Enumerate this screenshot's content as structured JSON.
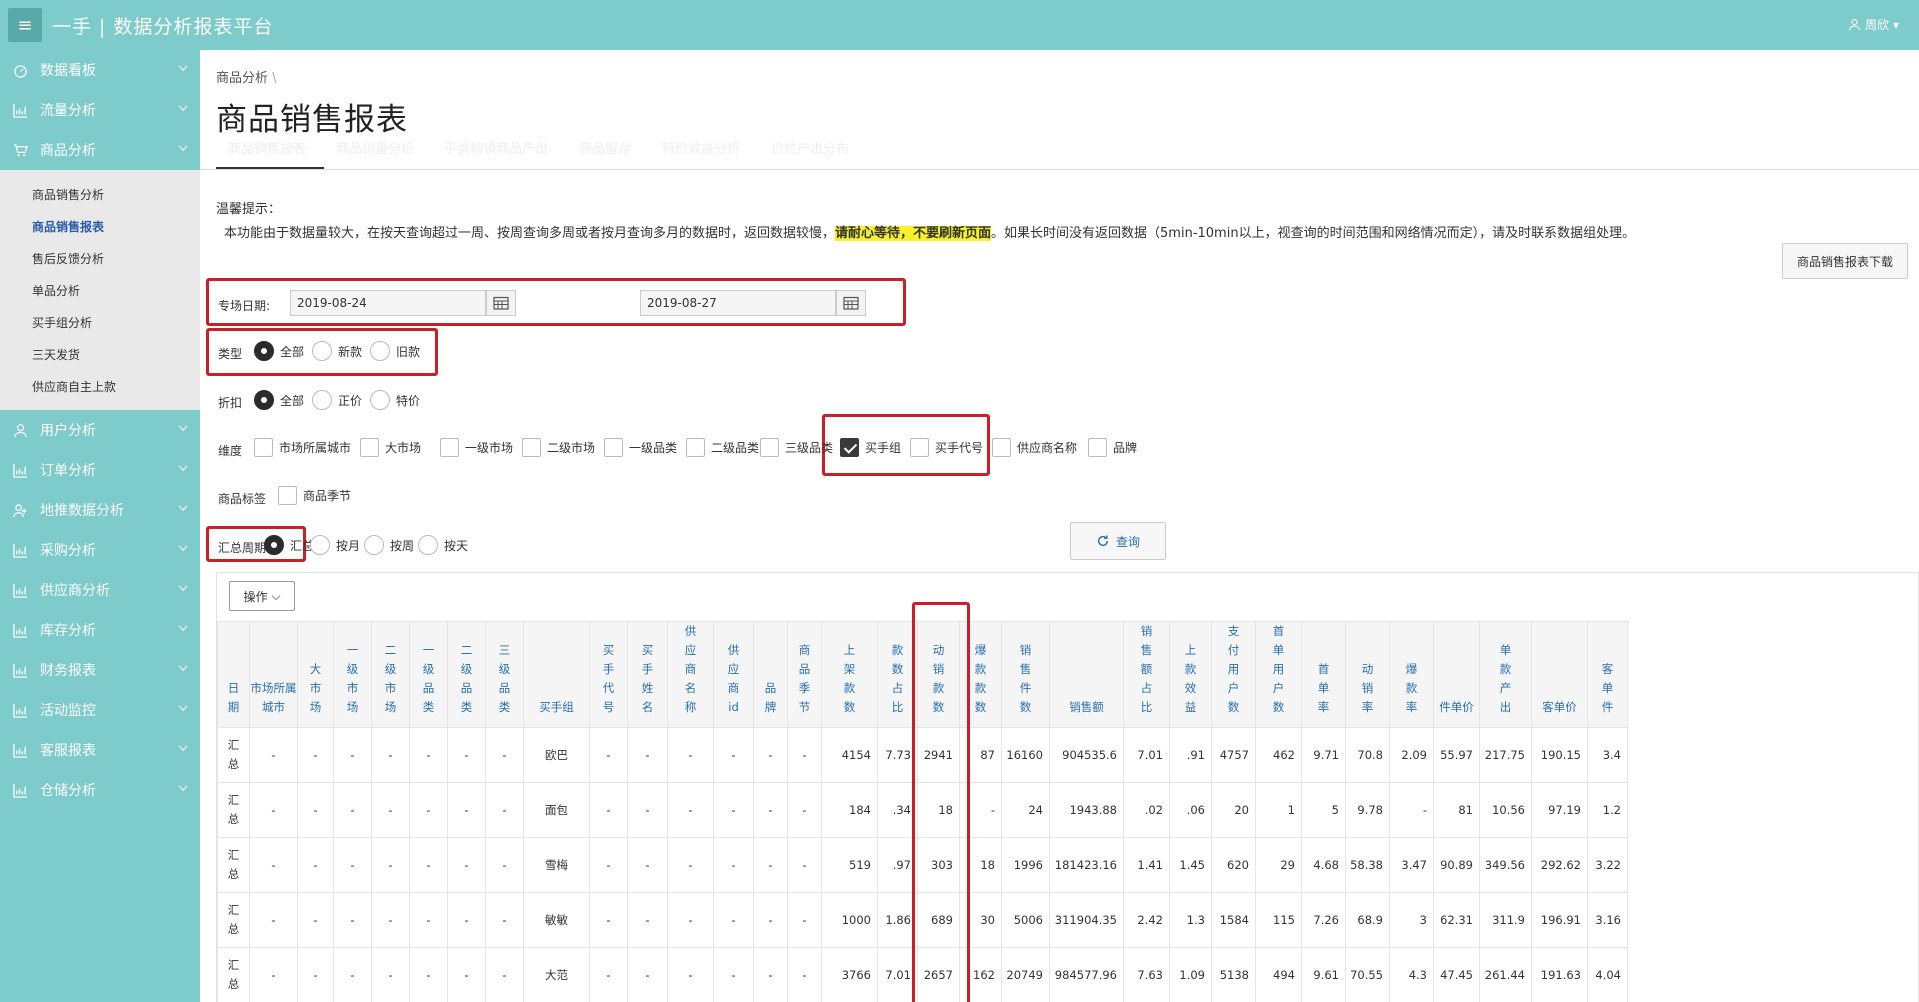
{
  "app": {
    "title": "一手 | 数据分析报表平台",
    "user": "周欣"
  },
  "sidebar": {
    "items": [
      {
        "label": "数据看板",
        "icon": "dashboard-icon"
      },
      {
        "label": "流量分析",
        "icon": "chart-icon"
      },
      {
        "label": "商品分析",
        "icon": "cart-icon"
      },
      {
        "label": "用户分析",
        "icon": "user-icon"
      },
      {
        "label": "订单分析",
        "icon": "chart-icon"
      },
      {
        "label": "地推数据分析",
        "icon": "user-plus-icon"
      },
      {
        "label": "采购分析",
        "icon": "chart-icon"
      },
      {
        "label": "供应商分析",
        "icon": "chart-icon"
      },
      {
        "label": "库存分析",
        "icon": "chart-icon"
      },
      {
        "label": "财务报表",
        "icon": "chart-icon"
      },
      {
        "label": "活动监控",
        "icon": "chart-icon"
      },
      {
        "label": "客服报表",
        "icon": "chart-icon"
      },
      {
        "label": "仓储分析",
        "icon": "chart-icon"
      }
    ],
    "sub_items": [
      "商品销售分析",
      "商品销售报表",
      "售后反馈分析",
      "单品分析",
      "买手组分析",
      "三天发货",
      "供应商自主上款"
    ]
  },
  "breadcrumb": "商品分析",
  "page_title": "商品销售报表",
  "tabs": [
    "商品销售报表",
    "商品销量分析",
    "平滑畅销商品产出",
    "商品留存",
    "特价效益分析",
    "价位产出分布"
  ],
  "notice": {
    "title": "温馨提示：",
    "before": "本功能由于数据量较大，在按天查询超过一周、按周查询多周或者按月查询多月的数据时，返回数据较慢，",
    "highlight": "请耐心等待，不要刷新页面",
    "after": "。如果长时间没有返回数据（5min-10min以上，视查询的时间范围和网络情况而定），请及时联系数据组处理。"
  },
  "download_label": "商品销售报表下载",
  "filters": {
    "date_label": "专场日期:",
    "date_start": "2019-08-24",
    "date_end": "2019-08-27",
    "type_label": "类型",
    "type_options": [
      "全部",
      "新款",
      "旧款"
    ],
    "discount_label": "折扣",
    "discount_options": [
      "全部",
      "正价",
      "特价"
    ],
    "dimension_label": "维度",
    "dimension_options": [
      "市场所属城市",
      "大市场",
      "一级市场",
      "二级市场",
      "一级品类",
      "二级品类",
      "三级品类",
      "买手组",
      "买手代号",
      "供应商名称",
      "品牌"
    ],
    "tag_label": "商品标签",
    "tag_options": [
      "商品季节"
    ],
    "period_label": "汇总周期",
    "period_options": [
      "汇总",
      "按月",
      "按周",
      "按天"
    ],
    "query_label": "查询"
  },
  "ops_label": "操作",
  "table": {
    "headers": [
      "日期",
      "市场所属城市",
      "大市场",
      "一级市场",
      "二级市场",
      "一级品类",
      "二级品类",
      "三级品类",
      "买手组",
      "买手代号",
      "买手姓名",
      "供应商名称",
      "供应商id",
      "品牌",
      "商品季节",
      "上架款数",
      "款数占比",
      "动销款数",
      "爆款款数",
      "销售件数",
      "销售额",
      "销售额占比",
      "上款效益",
      "支付用户数",
      "首单用户数",
      "首单率",
      "动销率",
      "爆款率",
      "件单价",
      "单款产出",
      "客单价",
      "客单件"
    ],
    "rows": [
      [
        "汇总",
        "-",
        "-",
        "-",
        "-",
        "-",
        "-",
        "-",
        "欧巴",
        "-",
        "-",
        "-",
        "-",
        "-",
        "-",
        "4154",
        "7.73",
        "2941",
        "87",
        "16160",
        "904535.6",
        "7.01",
        ".91",
        "4757",
        "462",
        "9.71",
        "70.8",
        "2.09",
        "55.97",
        "217.75",
        "190.15",
        "3.4"
      ],
      [
        "汇总",
        "-",
        "-",
        "-",
        "-",
        "-",
        "-",
        "-",
        "面包",
        "-",
        "-",
        "-",
        "-",
        "-",
        "-",
        "184",
        ".34",
        "18",
        "-",
        "24",
        "1943.88",
        ".02",
        ".06",
        "20",
        "1",
        "5",
        "9.78",
        "-",
        "81",
        "10.56",
        "97.19",
        "1.2"
      ],
      [
        "汇总",
        "-",
        "-",
        "-",
        "-",
        "-",
        "-",
        "-",
        "雪梅",
        "-",
        "-",
        "-",
        "-",
        "-",
        "-",
        "519",
        ".97",
        "303",
        "18",
        "1996",
        "181423.16",
        "1.41",
        "1.45",
        "620",
        "29",
        "4.68",
        "58.38",
        "3.47",
        "90.89",
        "349.56",
        "292.62",
        "3.22"
      ],
      [
        "汇总",
        "-",
        "-",
        "-",
        "-",
        "-",
        "-",
        "-",
        "敏敏",
        "-",
        "-",
        "-",
        "-",
        "-",
        "-",
        "1000",
        "1.86",
        "689",
        "30",
        "5006",
        "311904.35",
        "2.42",
        "1.3",
        "1584",
        "115",
        "7.26",
        "68.9",
        "3",
        "62.31",
        "311.9",
        "196.91",
        "3.16"
      ],
      [
        "汇总",
        "-",
        "-",
        "-",
        "-",
        "-",
        "-",
        "-",
        "大范",
        "-",
        "-",
        "-",
        "-",
        "-",
        "-",
        "3766",
        "7.01",
        "2657",
        "162",
        "20749",
        "984577.96",
        "7.63",
        "1.09",
        "5138",
        "494",
        "9.61",
        "70.55",
        "4.3",
        "47.45",
        "261.44",
        "191.63",
        "4.04"
      ]
    ]
  }
}
